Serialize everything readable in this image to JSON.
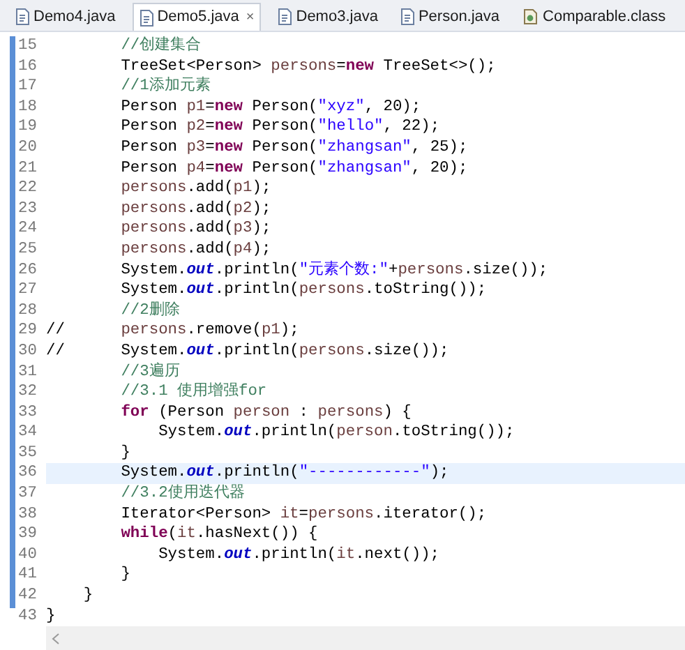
{
  "tabs": [
    {
      "label": "Demo4.java",
      "kind": "java",
      "selected": false,
      "closable": false
    },
    {
      "label": "Demo5.java",
      "kind": "java",
      "selected": true,
      "closable": true
    },
    {
      "label": "Demo3.java",
      "kind": "java",
      "selected": false,
      "closable": false
    },
    {
      "label": "Person.java",
      "kind": "java",
      "selected": false,
      "closable": false
    },
    {
      "label": "Comparable.class",
      "kind": "class",
      "selected": false,
      "closable": false
    }
  ],
  "close_glyph": "×",
  "lines": [
    {
      "number": "15",
      "highlighted": false,
      "segments": [
        {
          "kind": "cm",
          "text": "        //创建集合"
        }
      ]
    },
    {
      "number": "16",
      "highlighted": false,
      "segments": [
        {
          "kind": "t",
          "text": "        TreeSet<Person> "
        },
        {
          "kind": "var",
          "text": "persons"
        },
        {
          "kind": "t",
          "text": "="
        },
        {
          "kind": "kw",
          "text": "new"
        },
        {
          "kind": "t",
          "text": " TreeSet<>();"
        }
      ]
    },
    {
      "number": "17",
      "highlighted": false,
      "segments": [
        {
          "kind": "cm",
          "text": "        //1添加元素"
        }
      ]
    },
    {
      "number": "18",
      "highlighted": false,
      "segments": [
        {
          "kind": "t",
          "text": "        Person "
        },
        {
          "kind": "var",
          "text": "p1"
        },
        {
          "kind": "t",
          "text": "="
        },
        {
          "kind": "kw",
          "text": "new"
        },
        {
          "kind": "t",
          "text": " Person("
        },
        {
          "kind": "str",
          "text": "\"xyz\""
        },
        {
          "kind": "t",
          "text": ", 20);"
        }
      ]
    },
    {
      "number": "19",
      "highlighted": false,
      "segments": [
        {
          "kind": "t",
          "text": "        Person "
        },
        {
          "kind": "var",
          "text": "p2"
        },
        {
          "kind": "t",
          "text": "="
        },
        {
          "kind": "kw",
          "text": "new"
        },
        {
          "kind": "t",
          "text": " Person("
        },
        {
          "kind": "str",
          "text": "\"hello\""
        },
        {
          "kind": "t",
          "text": ", 22);"
        }
      ]
    },
    {
      "number": "20",
      "highlighted": false,
      "segments": [
        {
          "kind": "t",
          "text": "        Person "
        },
        {
          "kind": "var",
          "text": "p3"
        },
        {
          "kind": "t",
          "text": "="
        },
        {
          "kind": "kw",
          "text": "new"
        },
        {
          "kind": "t",
          "text": " Person("
        },
        {
          "kind": "str",
          "text": "\"zhangsan\""
        },
        {
          "kind": "t",
          "text": ", 25);"
        }
      ]
    },
    {
      "number": "21",
      "highlighted": false,
      "segments": [
        {
          "kind": "t",
          "text": "        Person "
        },
        {
          "kind": "var",
          "text": "p4"
        },
        {
          "kind": "t",
          "text": "="
        },
        {
          "kind": "kw",
          "text": "new"
        },
        {
          "kind": "t",
          "text": " Person("
        },
        {
          "kind": "str",
          "text": "\"zhangsan\""
        },
        {
          "kind": "t",
          "text": ", 20);"
        }
      ]
    },
    {
      "number": "22",
      "highlighted": false,
      "segments": [
        {
          "kind": "var",
          "text": "        persons"
        },
        {
          "kind": "t",
          "text": ".add("
        },
        {
          "kind": "var",
          "text": "p1"
        },
        {
          "kind": "t",
          "text": ");"
        }
      ]
    },
    {
      "number": "23",
      "highlighted": false,
      "segments": [
        {
          "kind": "var",
          "text": "        persons"
        },
        {
          "kind": "t",
          "text": ".add("
        },
        {
          "kind": "var",
          "text": "p2"
        },
        {
          "kind": "t",
          "text": ");"
        }
      ]
    },
    {
      "number": "24",
      "highlighted": false,
      "segments": [
        {
          "kind": "var",
          "text": "        persons"
        },
        {
          "kind": "t",
          "text": ".add("
        },
        {
          "kind": "var",
          "text": "p3"
        },
        {
          "kind": "t",
          "text": ");"
        }
      ]
    },
    {
      "number": "25",
      "highlighted": false,
      "segments": [
        {
          "kind": "var",
          "text": "        persons"
        },
        {
          "kind": "t",
          "text": ".add("
        },
        {
          "kind": "var",
          "text": "p4"
        },
        {
          "kind": "t",
          "text": ");"
        }
      ]
    },
    {
      "number": "26",
      "highlighted": false,
      "segments": [
        {
          "kind": "t",
          "text": "        System."
        },
        {
          "kind": "fld",
          "text": "out"
        },
        {
          "kind": "t",
          "text": ".println("
        },
        {
          "kind": "str",
          "text": "\"元素个数:\""
        },
        {
          "kind": "t",
          "text": "+"
        },
        {
          "kind": "var",
          "text": "persons"
        },
        {
          "kind": "t",
          "text": ".size());"
        }
      ]
    },
    {
      "number": "27",
      "highlighted": false,
      "segments": [
        {
          "kind": "t",
          "text": "        System."
        },
        {
          "kind": "fld",
          "text": "out"
        },
        {
          "kind": "t",
          "text": ".println("
        },
        {
          "kind": "var",
          "text": "persons"
        },
        {
          "kind": "t",
          "text": ".toString());"
        }
      ]
    },
    {
      "number": "28",
      "highlighted": false,
      "segments": [
        {
          "kind": "cm",
          "text": "        //2删除"
        }
      ]
    },
    {
      "number": "29",
      "highlighted": false,
      "segments": [
        {
          "kind": "t",
          "text": "//      "
        },
        {
          "kind": "var",
          "text": "persons"
        },
        {
          "kind": "t",
          "text": ".remove("
        },
        {
          "kind": "var",
          "text": "p1"
        },
        {
          "kind": "t",
          "text": ");"
        }
      ]
    },
    {
      "number": "30",
      "highlighted": false,
      "segments": [
        {
          "kind": "t",
          "text": "//      System."
        },
        {
          "kind": "fld",
          "text": "out"
        },
        {
          "kind": "t",
          "text": ".println("
        },
        {
          "kind": "var",
          "text": "persons"
        },
        {
          "kind": "t",
          "text": ".size());"
        }
      ]
    },
    {
      "number": "31",
      "highlighted": false,
      "segments": [
        {
          "kind": "cm",
          "text": "        //3遍历"
        }
      ]
    },
    {
      "number": "32",
      "highlighted": false,
      "segments": [
        {
          "kind": "cm",
          "text": "        //3.1 使用增强for"
        }
      ]
    },
    {
      "number": "33",
      "highlighted": false,
      "segments": [
        {
          "kind": "kw",
          "text": "        for"
        },
        {
          "kind": "t",
          "text": " (Person "
        },
        {
          "kind": "var",
          "text": "person"
        },
        {
          "kind": "t",
          "text": " : "
        },
        {
          "kind": "var",
          "text": "persons"
        },
        {
          "kind": "t",
          "text": ") {"
        }
      ]
    },
    {
      "number": "34",
      "highlighted": false,
      "segments": [
        {
          "kind": "t",
          "text": "            System."
        },
        {
          "kind": "fld",
          "text": "out"
        },
        {
          "kind": "t",
          "text": ".println("
        },
        {
          "kind": "var",
          "text": "person"
        },
        {
          "kind": "t",
          "text": ".toString());"
        }
      ]
    },
    {
      "number": "35",
      "highlighted": false,
      "segments": [
        {
          "kind": "t",
          "text": "        }"
        }
      ]
    },
    {
      "number": "36",
      "highlighted": true,
      "segments": [
        {
          "kind": "t",
          "text": "        System."
        },
        {
          "kind": "fld",
          "text": "out"
        },
        {
          "kind": "t",
          "text": ".println("
        },
        {
          "kind": "str",
          "text": "\"------------\""
        },
        {
          "kind": "t",
          "text": ");"
        }
      ]
    },
    {
      "number": "37",
      "highlighted": false,
      "segments": [
        {
          "kind": "cm",
          "text": "        //3.2使用迭代器"
        }
      ]
    },
    {
      "number": "38",
      "highlighted": false,
      "segments": [
        {
          "kind": "t",
          "text": "        Iterator<Person> "
        },
        {
          "kind": "var",
          "text": "it"
        },
        {
          "kind": "t",
          "text": "="
        },
        {
          "kind": "var",
          "text": "persons"
        },
        {
          "kind": "t",
          "text": ".iterator();"
        }
      ]
    },
    {
      "number": "39",
      "highlighted": false,
      "segments": [
        {
          "kind": "kw",
          "text": "        while"
        },
        {
          "kind": "t",
          "text": "("
        },
        {
          "kind": "var",
          "text": "it"
        },
        {
          "kind": "t",
          "text": ".hasNext()) {"
        }
      ]
    },
    {
      "number": "40",
      "highlighted": false,
      "segments": [
        {
          "kind": "t",
          "text": "            System."
        },
        {
          "kind": "fld",
          "text": "out"
        },
        {
          "kind": "t",
          "text": ".println("
        },
        {
          "kind": "var",
          "text": "it"
        },
        {
          "kind": "t",
          "text": ".next());"
        }
      ]
    },
    {
      "number": "41",
      "highlighted": false,
      "segments": [
        {
          "kind": "t",
          "text": "        }"
        }
      ]
    },
    {
      "number": "42",
      "highlighted": false,
      "segments": [
        {
          "kind": "t",
          "text": "    }"
        }
      ]
    },
    {
      "number": "43",
      "highlighted": false,
      "segments": [
        {
          "kind": "t",
          "text": "}"
        }
      ]
    }
  ]
}
